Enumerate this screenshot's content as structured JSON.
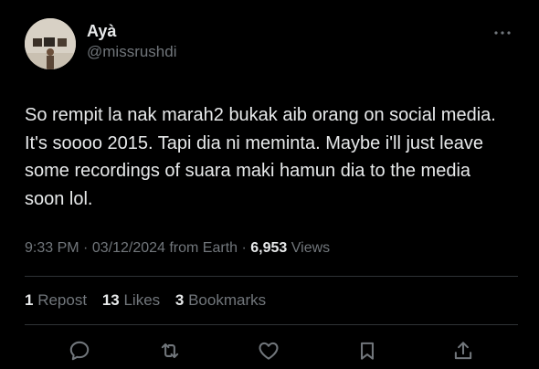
{
  "author": {
    "display_name": "Ayà",
    "handle": "@missrushdi",
    "avatar_icon": "profile-photo"
  },
  "tweet": {
    "text": "So rempit la nak marah2 bukak aib orang on social media. It's soooo 2015. Tapi dia ni meminta. Maybe i'll just leave some recordings of suara maki hamun dia to the media soon lol.",
    "time": "9:33 PM",
    "separator": "·",
    "date": "03/12/2024",
    "source": "from Earth",
    "views_count": "6,953",
    "views_label": "Views"
  },
  "stats": {
    "reposts_count": "1",
    "reposts_label": "Repost",
    "likes_count": "13",
    "likes_label": "Likes",
    "bookmarks_count": "3",
    "bookmarks_label": "Bookmarks"
  },
  "actions": [
    {
      "name": "reply",
      "icon": "reply-icon"
    },
    {
      "name": "repost",
      "icon": "repost-icon"
    },
    {
      "name": "like",
      "icon": "heart-icon"
    },
    {
      "name": "bookmark",
      "icon": "bookmark-icon"
    },
    {
      "name": "share",
      "icon": "share-icon"
    }
  ],
  "colors": {
    "background": "#000000",
    "text_primary": "#e7e9ea",
    "text_secondary": "#71767b",
    "divider": "#2f3336"
  }
}
